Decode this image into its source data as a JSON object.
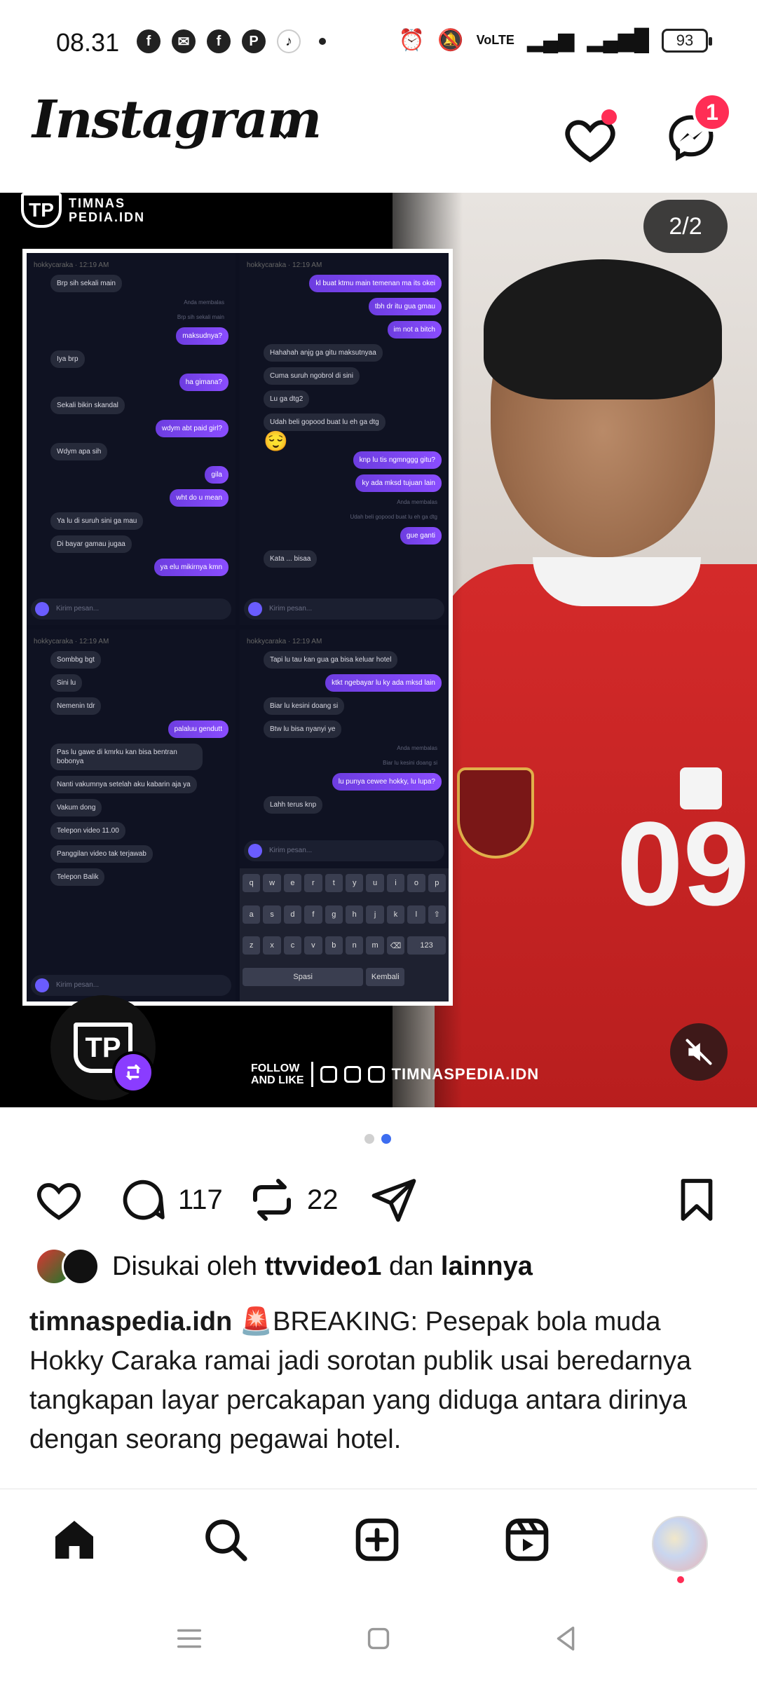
{
  "status_bar": {
    "time": "08.31",
    "battery": "93",
    "left_icons": [
      "facebook-icon",
      "messenger-icon",
      "facebook-icon",
      "pinterest-icon",
      "tiktok-icon"
    ],
    "right_icons": [
      "alarm-icon",
      "mute-icon",
      "volte-icon",
      "signal-icon",
      "4g-signal-icon",
      "battery-icon"
    ]
  },
  "header": {
    "logo": "Instagram",
    "notification_badge": "1",
    "accent_color": "#ff2d55"
  },
  "post": {
    "brand_name_line1": "TIMNAS",
    "brand_name_line2": "PEDIA.IDN",
    "brand_mark": "TP",
    "page_indicator": "2/2",
    "follow_line1": "FOLLOW",
    "follow_line2": "AND LIKE",
    "follow_handle": "TIMNASPEDIA.IDN",
    "shirt_number": "09",
    "collage": {
      "panel1": {
        "header": "hokkycaraka · 12:19 AM",
        "messages": [
          {
            "type": "in",
            "text": "Brp sih sekali main"
          },
          {
            "type": "sys",
            "text": "Anda membalas"
          },
          {
            "type": "sys",
            "text": "Brp sih sekali main"
          },
          {
            "type": "out",
            "text": "maksudnya?"
          },
          {
            "type": "in",
            "text": "Iya brp"
          },
          {
            "type": "out",
            "text": "ha gimana?"
          },
          {
            "type": "in",
            "text": "Sekali bikin skandal"
          },
          {
            "type": "out",
            "text": "wdym abt paid girl?"
          },
          {
            "type": "in",
            "text": "Wdym apa sih"
          },
          {
            "type": "out",
            "text": "gila"
          },
          {
            "type": "out",
            "text": "wht do u mean"
          },
          {
            "type": "in",
            "text": "Ya lu di suruh sini ga mau"
          },
          {
            "type": "in",
            "text": "Di bayar gamau jugaa"
          },
          {
            "type": "out",
            "text": "ya elu mikirnya kmn"
          }
        ],
        "input_placeholder": "Kirim pesan..."
      },
      "panel2": {
        "header": "hokkycaraka · 12:19 AM",
        "messages": [
          {
            "type": "out",
            "text": "kl buat ktmu main temenan ma its okei"
          },
          {
            "type": "out",
            "text": "tbh dr itu gua gmau"
          },
          {
            "type": "out",
            "text": "im not a bitch"
          },
          {
            "type": "in",
            "text": "Hahahah anjg ga gitu maksutnyaa"
          },
          {
            "type": "in",
            "text": "Cuma suruh ngobrol di sini"
          },
          {
            "type": "in",
            "text": "Lu ga dtg2"
          },
          {
            "type": "in",
            "text": "Udah beli gopood buat lu eh ga dtg"
          },
          {
            "type": "emoji",
            "text": "😌"
          },
          {
            "type": "out",
            "text": "knp lu tis ngmnggg gitu?"
          },
          {
            "type": "out",
            "text": "ky ada mksd tujuan lain"
          },
          {
            "type": "sys",
            "text": "Anda membalas"
          },
          {
            "type": "sys",
            "text": "Udah beli gopood buat lu eh ga dtg"
          },
          {
            "type": "out",
            "text": "gue ganti"
          },
          {
            "type": "in",
            "text": "Kata ... bisaa"
          }
        ],
        "input_placeholder": "Kirim pesan..."
      },
      "panel3": {
        "header": "hokkycaraka · 12:19 AM",
        "messages": [
          {
            "type": "in",
            "text": "Sombbg bgt"
          },
          {
            "type": "in",
            "text": "Sini lu"
          },
          {
            "type": "in",
            "text": "Nemenin tdr"
          },
          {
            "type": "out",
            "text": "palaluu gendutt"
          },
          {
            "type": "in",
            "text": "Pas lu gawe di kmrku kan bisa bentran bobonya"
          },
          {
            "type": "in",
            "text": "Nanti vakumnya setelah aku kabarin aja ya"
          },
          {
            "type": "in",
            "text": "Vakum dong"
          },
          {
            "type": "in",
            "text": "Telepon video 11.00"
          },
          {
            "type": "in",
            "text": "Panggilan video tak terjawab"
          },
          {
            "type": "in",
            "text": "Telepon Balik"
          }
        ],
        "input_placeholder": "Kirim pesan..."
      },
      "panel4": {
        "header": "hokkycaraka · 12:19 AM",
        "messages": [
          {
            "type": "in",
            "text": "Tapi lu tau kan gua ga bisa keluar hotel"
          },
          {
            "type": "out",
            "text": "ktkt ngebayar lu ky ada mksd lain"
          },
          {
            "type": "in",
            "text": "Biar lu kesini doang si"
          },
          {
            "type": "in",
            "text": "Btw lu bisa nyanyi ye"
          },
          {
            "type": "sys",
            "text": "Anda membalas"
          },
          {
            "type": "sys",
            "text": "Biar lu kesini doang si"
          },
          {
            "type": "out",
            "text": "lu punya cewee hokky, lu lupa?"
          },
          {
            "type": "in",
            "text": "Lahh terus knp"
          }
        ],
        "input_placeholder": "Kirim pesan...",
        "keyboard_row1": [
          "q",
          "w",
          "e",
          "r",
          "t",
          "y",
          "u",
          "i",
          "o",
          "p"
        ],
        "keyboard_row2": [
          "a",
          "s",
          "d",
          "f",
          "g",
          "h",
          "j",
          "k",
          "l"
        ],
        "keyboard_row3": [
          "⇧",
          "z",
          "x",
          "c",
          "v",
          "b",
          "n",
          "m",
          "⌫"
        ],
        "keyboard_row4": [
          "123",
          "Spasi",
          "Kembali"
        ]
      }
    }
  },
  "carousel": {
    "count": 2,
    "active": 2
  },
  "actions": {
    "comments": "117",
    "reposts": "22"
  },
  "likes": {
    "prefix": "Disukai oleh",
    "user": "ttvvideo1",
    "conjunction": "dan",
    "others": "lainnya"
  },
  "caption": {
    "username": "timnaspedia.idn",
    "emoji": "🚨",
    "text": "BREAKING: Pesepak bola muda Hokky Caraka ramai jadi sorotan publik usai beredarnya tangkapan layar percakapan yang diduga antara dirinya dengan seorang pegawai hotel."
  },
  "bottom_nav": [
    "home-icon",
    "search-icon",
    "create-icon",
    "reels-icon",
    "profile-avatar"
  ],
  "system_nav": [
    "recents-icon",
    "home-square-icon",
    "back-icon"
  ]
}
